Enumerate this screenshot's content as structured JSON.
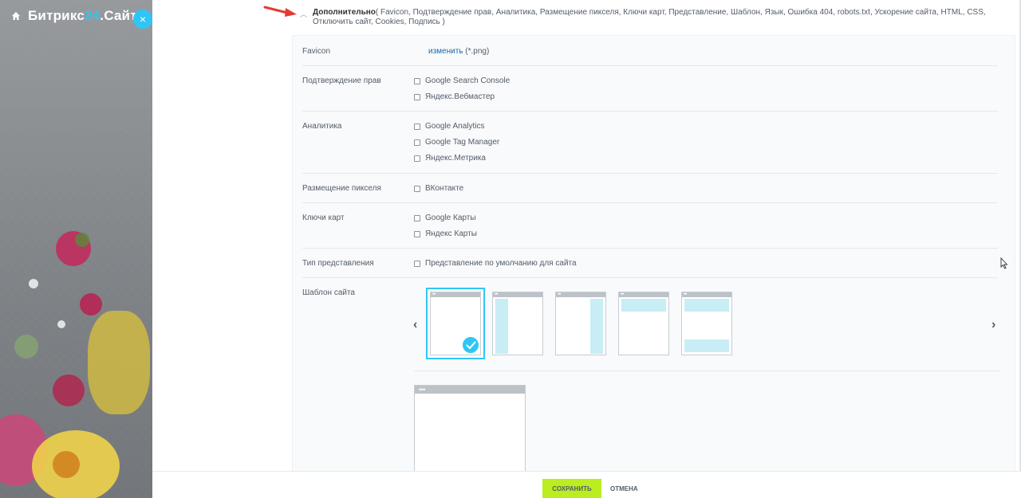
{
  "app": {
    "logo_prefix": "Битрикс",
    "logo_num": "24",
    "logo_suffix": ".Сайты",
    "close_label": "×"
  },
  "advanced": {
    "toggle_icon": "chevron-up-icon",
    "title": "Дополнительно",
    "summary": "( Favicon,  Подтверждение прав,  Аналитика,  Размещение пикселя,  Ключи карт,  Представление,  Шаблон,  Язык,  Ошибка 404,  robots.txt,  Ускорение сайта,  HTML,  CSS,  Отключить сайт,  Cookies,  Подпись )"
  },
  "rows": {
    "favicon": {
      "label": "Favicon",
      "link": "изменить",
      "hint": " (*.png)"
    },
    "rights": {
      "label": "Подтверждение прав",
      "options": [
        "Google Search Console",
        "Яндекс.Вебмастер"
      ]
    },
    "analytics": {
      "label": "Аналитика",
      "options": [
        "Google Analytics",
        "Google Tag Manager",
        "Яндекс.Метрика"
      ]
    },
    "pixel": {
      "label": "Размещение пикселя",
      "options": [
        "ВКонтакте"
      ]
    },
    "maps": {
      "label": "Ключи карт",
      "options": [
        "Google Карты",
        "Яндекс Карты"
      ]
    },
    "view": {
      "label": "Тип представления",
      "options": [
        "Представление по умолчанию для сайта"
      ]
    },
    "template": {
      "label": "Шаблон сайта",
      "dots": "•••",
      "prev_icon": "chevron-left-icon",
      "next_icon": "chevron-right-icon",
      "prev_glyph": "‹",
      "next_glyph": "›"
    }
  },
  "footer": {
    "save": "СОХРАНИТЬ",
    "cancel": "ОТМЕНА"
  },
  "colors": {
    "accent": "#2fc6f6",
    "save": "#bbed21",
    "link": "#2067b0",
    "annotation_arrow": "#e53935"
  }
}
